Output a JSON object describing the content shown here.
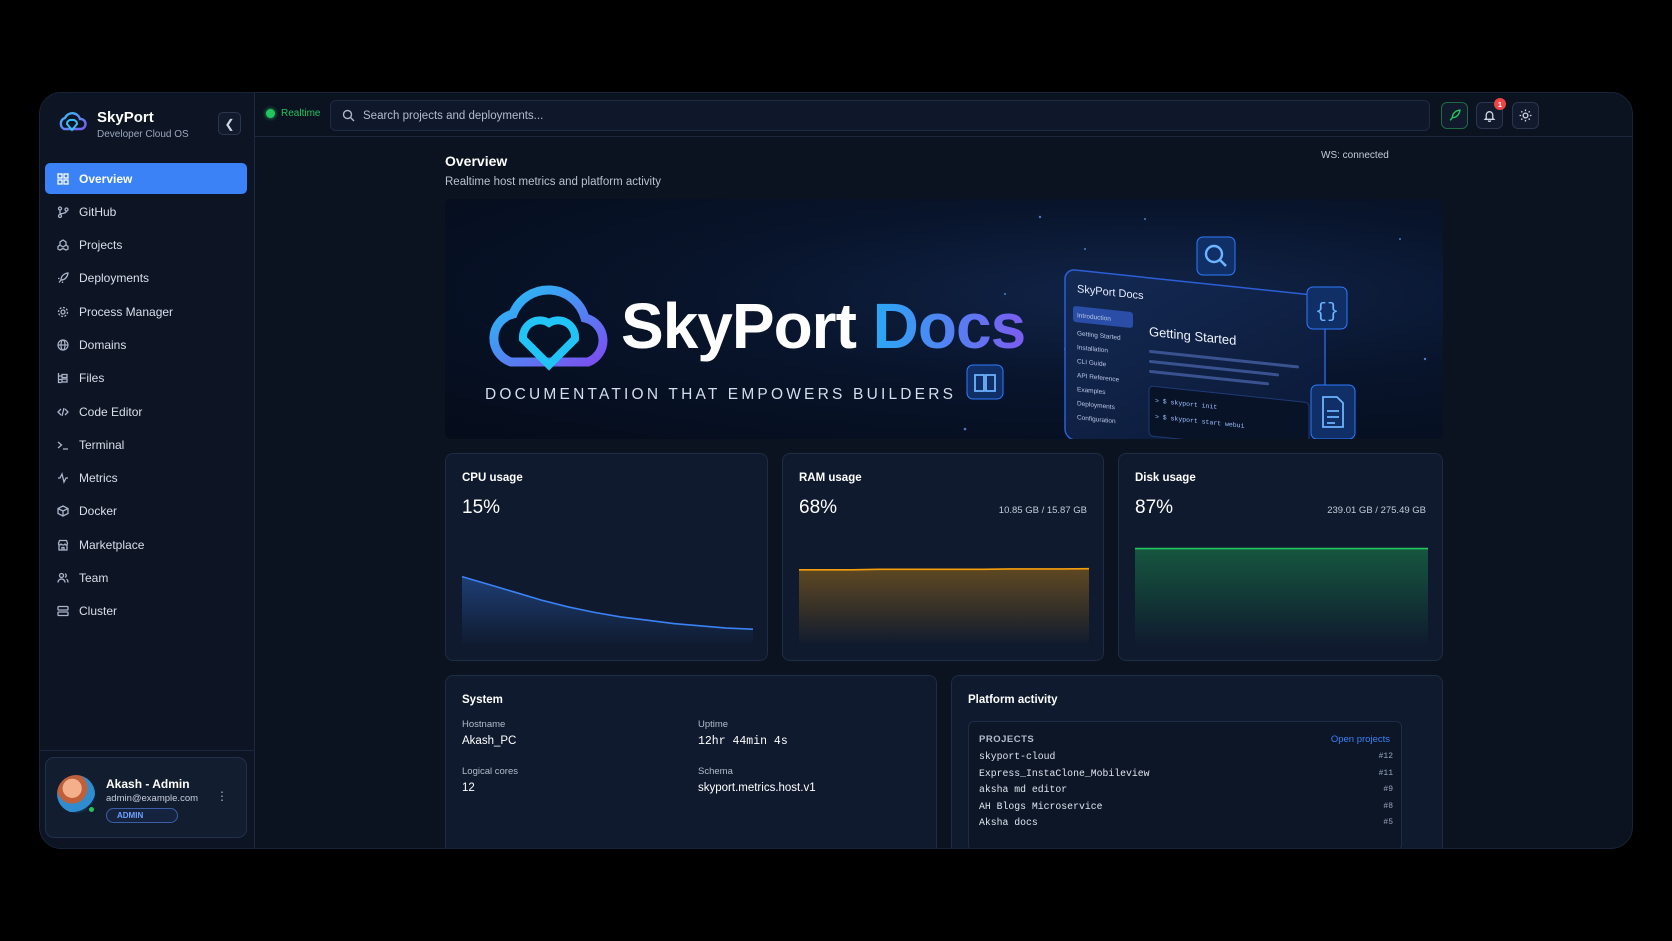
{
  "brand": {
    "title": "SkyPort",
    "subtitle": "Developer Cloud OS"
  },
  "nav": [
    {
      "label": "Overview",
      "icon": "grid-icon",
      "active": true
    },
    {
      "label": "GitHub",
      "icon": "git-branch-icon"
    },
    {
      "label": "Projects",
      "icon": "projects-icon"
    },
    {
      "label": "Deployments",
      "icon": "rocket-icon"
    },
    {
      "label": "Process Manager",
      "icon": "cpu-icon"
    },
    {
      "label": "Domains",
      "icon": "globe-icon"
    },
    {
      "label": "Files",
      "icon": "files-icon"
    },
    {
      "label": "Code Editor",
      "icon": "code-icon"
    },
    {
      "label": "Terminal",
      "icon": "terminal-icon"
    },
    {
      "label": "Metrics",
      "icon": "activity-icon"
    },
    {
      "label": "Docker",
      "icon": "container-icon"
    },
    {
      "label": "Marketplace",
      "icon": "store-icon"
    },
    {
      "label": "Team",
      "icon": "users-icon"
    },
    {
      "label": "Cluster",
      "icon": "server-icon"
    }
  ],
  "profile": {
    "name": "Akash - Admin",
    "email": "admin@example.com",
    "role": "ADMIN"
  },
  "topbar": {
    "status": "Realtime",
    "search_placeholder": "Search projects and deployments...",
    "notification_count": "1"
  },
  "overview": {
    "title": "Overview",
    "subtitle": "Realtime host metrics and platform activity",
    "ws_status": "WS: connected"
  },
  "banner": {
    "title_main": "SkyPort",
    "title_accent": "Docs",
    "tagline": "DOCUMENTATION THAT EMPOWERS BUILDERS",
    "doc_window_title": "SkyPort Docs",
    "doc_heading": "Getting Started",
    "doc_menu": [
      "Introduction",
      "Getting Started",
      "Installation",
      "CLI Guide",
      "API Reference",
      "Examples",
      "Deployments",
      "Configuration"
    ],
    "doc_code": [
      "> $ skyport init",
      "> $ skyport start webui"
    ]
  },
  "metrics": [
    {
      "title": "CPU usage",
      "value": "15%",
      "extra": "",
      "color": "#3b82f6",
      "series": [
        0.62,
        0.55,
        0.48,
        0.41,
        0.35,
        0.3,
        0.26,
        0.23,
        0.2,
        0.18,
        0.16,
        0.15
      ]
    },
    {
      "title": "RAM usage",
      "value": "68%",
      "extra": "10.85 GB / 15.87 GB",
      "color": "#f59e0b",
      "series": [
        0.68,
        0.68,
        0.68,
        0.685,
        0.685,
        0.685,
        0.685,
        0.685,
        0.688,
        0.688,
        0.688,
        0.69
      ]
    },
    {
      "title": "Disk usage",
      "value": "87%",
      "extra": "239.01 GB / 275.49 GB",
      "color": "#22c55e",
      "series": [
        0.87,
        0.87,
        0.87,
        0.87,
        0.87,
        0.87,
        0.87,
        0.87,
        0.87,
        0.87,
        0.87,
        0.87
      ]
    }
  ],
  "system": {
    "title": "System",
    "hostname_label": "Hostname",
    "hostname": "Akash_PC",
    "uptime_label": "Uptime",
    "uptime": "12hr 44min 4s",
    "cores_label": "Logical cores",
    "cores": "12",
    "schema_label": "Schema",
    "schema": "skyport.metrics.host.v1"
  },
  "activity": {
    "title": "Platform activity",
    "projects_label": "PROJECTS",
    "open_link": "Open projects",
    "projects": [
      {
        "name": "skyport-cloud",
        "id": "#12"
      },
      {
        "name": "Express_InstaClone_Mobileview",
        "id": "#11"
      },
      {
        "name": "aksha md editor",
        "id": "#9"
      },
      {
        "name": "AH Blogs Microservice",
        "id": "#8"
      },
      {
        "name": "Aksha docs",
        "id": "#5"
      }
    ]
  },
  "colors": {
    "accent": "#3b82f6",
    "online": "#22c55e",
    "alert": "#ef4444"
  }
}
